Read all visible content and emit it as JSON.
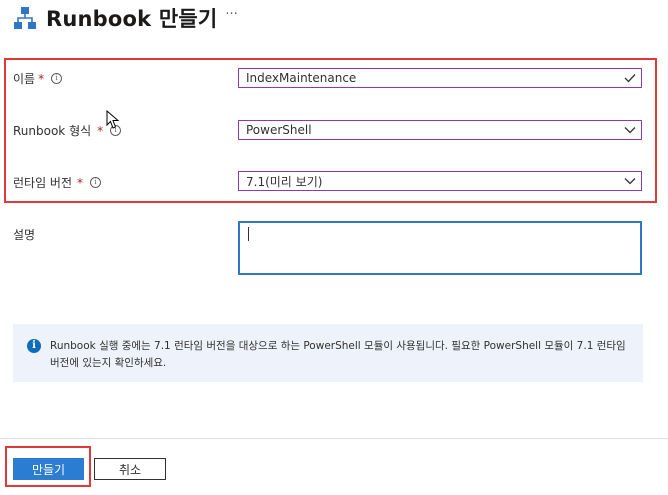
{
  "header": {
    "title": "Runbook 만들기",
    "more": "···"
  },
  "form": {
    "name": {
      "label": "이름",
      "required": "*",
      "value": "IndexMaintenance"
    },
    "runbook_type": {
      "label": "Runbook 형식",
      "required": "*",
      "value": "PowerShell"
    },
    "runtime_version": {
      "label": "런타임 버전",
      "required": "*",
      "value": "7.1(미리 보기)"
    },
    "description": {
      "label": "설명",
      "value": ""
    }
  },
  "info_banner": {
    "text": "Runbook 실행 중에는 7.1 런타임 버전을 대상으로 하는 PowerShell 모듈이 사용됩니다. 필요한 PowerShell 모듈이 7.1 런타임 버전에 있는지 확인하세요."
  },
  "footer": {
    "create_label": "만들기",
    "cancel_label": "취소"
  },
  "colors": {
    "accent": "#2b7cd3",
    "highlight": "#e0393a",
    "field_border": "#8a3ab9"
  }
}
